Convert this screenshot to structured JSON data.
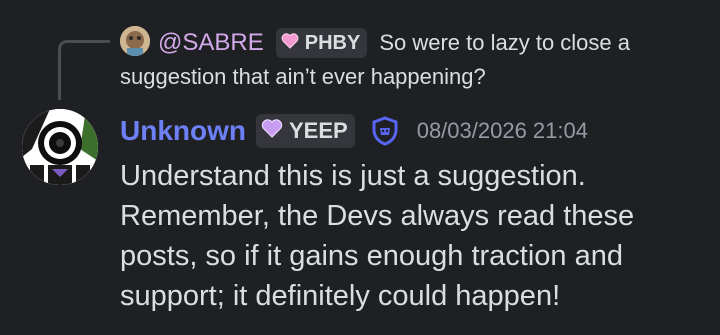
{
  "reply": {
    "author": "@SABRE",
    "badge_label": "PHBY",
    "snippet_line1": "So were to lazy to close a",
    "snippet_line2": "suggestion that ain’t ever happening?",
    "author_color": "#d2a9e8",
    "badge_icon": "pink-heart-icon"
  },
  "message": {
    "author": "Unknown",
    "author_color": "#6e80f5",
    "badge_label": "YEEP",
    "badge_icon": "purple-heart-icon",
    "role_icon": "moderator-shield-icon",
    "timestamp": "08/03/2026 21:04",
    "lines": [
      "Understand this is just a suggestion.",
      "Remember, the Devs always read these",
      "posts, so if it gains enough traction and",
      "support; it definitely could happen!"
    ]
  }
}
